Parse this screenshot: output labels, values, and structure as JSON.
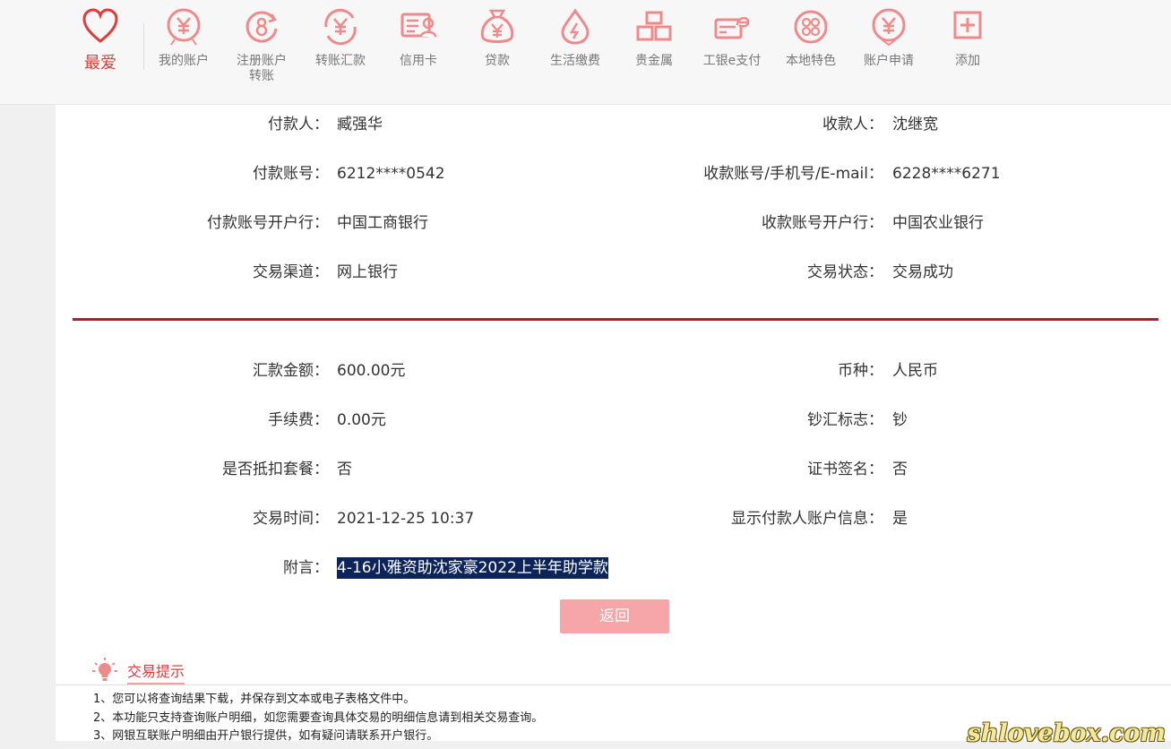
{
  "nav": {
    "favorite": "最爱",
    "items": [
      {
        "label": "我的账户",
        "icon": "yen-circle-icon"
      },
      {
        "label": "注册账户\n转账",
        "icon": "transfer-circle-icon"
      },
      {
        "label": "转账汇款",
        "icon": "yen-refresh-icon"
      },
      {
        "label": "信用卡",
        "icon": "credit-card-icon"
      },
      {
        "label": "贷款",
        "icon": "money-bag-icon"
      },
      {
        "label": "生活缴费",
        "icon": "utility-drop-icon"
      },
      {
        "label": "贵金属",
        "icon": "gold-bars-icon"
      },
      {
        "label": "工银e支付",
        "icon": "e-pay-icon"
      },
      {
        "label": "本地特色",
        "icon": "local-dots-icon"
      },
      {
        "label": "账户申请",
        "icon": "yen-circle-icon"
      },
      {
        "label": "添加",
        "icon": "plus-square-icon"
      }
    ],
    "accent": "#e03b3b",
    "icon_color": "#f08a8a"
  },
  "details": {
    "payer_label": "付款人：",
    "payer": "臧强华",
    "payee_label": "收款人：",
    "payee": "沈继宽",
    "payer_account_label": "付款账号：",
    "payer_account": "6212****0542",
    "payee_account_label": "收款账号/手机号/E-mail：",
    "payee_account": "6228****6271",
    "payer_bank_label": "付款账号开户行：",
    "payer_bank": "中国工商银行",
    "payee_bank_label": "收款账号开户行：",
    "payee_bank": "中国农业银行",
    "channel_label": "交易渠道：",
    "channel": "网上银行",
    "status_label": "交易状态：",
    "status": "交易成功",
    "amount_label": "汇款金额：",
    "amount": "600.00元",
    "currency_label": "币种：",
    "currency": "人民币",
    "fee_label": "手续费：",
    "fee": "0.00元",
    "cash_flag_label": "钞汇标志：",
    "cash_flag": "钞",
    "package_label": "是否抵扣套餐：",
    "package": "否",
    "cert_sign_label": "证书签名：",
    "cert_sign": "否",
    "time_label": "交易时间：",
    "time": "2021-12-25 10:37",
    "show_payer_label": "显示付款人账户信息：",
    "show_payer": "是",
    "remark_label": "附言：",
    "remark": "4-16小雅资助沈家豪2022上半年助学款"
  },
  "back_button": "返回",
  "tips": {
    "title": "交易提示",
    "items": [
      "1、您可以将查询结果下载，并保存到文本或电子表格文件中。",
      "2、本功能只支持查询账户明细，如您需要查询具体交易的明细信息请到相关交易查询。",
      "3、网银互联账户明细由开户银行提供，如有疑问请联系开户银行。"
    ]
  },
  "watermark": "shlovebox.com",
  "colors": {
    "divider_red": "#c4161c",
    "back_button": "#f6a6a9",
    "highlight": "#0c2459"
  }
}
